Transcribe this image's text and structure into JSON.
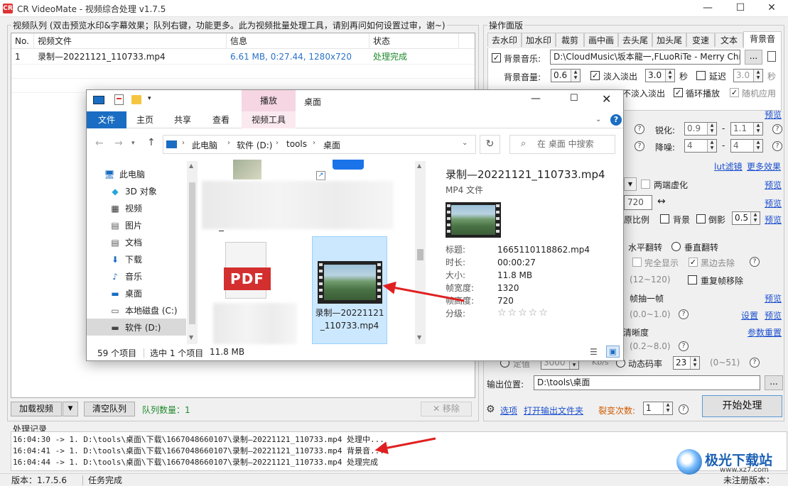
{
  "window": {
    "app_badge": "CR",
    "title": "CR VideoMate - 视频综合处理 v1.7.5",
    "minimize": "—",
    "maximize": "☐",
    "close": "✕"
  },
  "queue": {
    "label": "视频队列 (双击预览水印&字幕效果；队列右键，功能更多。此为视频批量处理工具，请别再问如何设置过审，谢~)",
    "columns": [
      "No.",
      "视频文件",
      "信息",
      "状态"
    ],
    "rows": [
      {
        "no": "1",
        "file": "录制—20221121_110733.mp4",
        "info": "6.61 MB, 0:27.44, 1280x720",
        "status": "处理完成"
      }
    ],
    "load_btn": "加载视频",
    "load_dropdown": "▼",
    "clear_btn": "清空队列",
    "count_label": "队列数量：1",
    "remove_btn": "✕ 移除",
    "colors": {
      "info": "#2a73c9",
      "status": "#1f8a2b"
    }
  },
  "panel": {
    "label": "操作面版",
    "tabs": [
      "去水印",
      "加水印",
      "裁剪",
      "画中画",
      "去头尾",
      "加头尾",
      "变速",
      "文本",
      "背景音"
    ],
    "active_tab": "背景音",
    "bgm_label": "背景音乐:",
    "bgm_path": "D:\\CloudMusic\\坂本龍一,FLuoRiTe - Merry Christ",
    "browse": "...",
    "volume_label": "背景音量:",
    "volume": "0.6",
    "fade_label": "淡入淡出",
    "fade_val": "3.0",
    "sec1": "秒",
    "delay_label": "延迟",
    "delay_val": "3.0",
    "sec2": "秒",
    "fade2_label": "不淡入淡出",
    "loop_label": "循环播放",
    "random_label": "随机应用",
    "preview": "预览",
    "sharpen_label": "锐化:",
    "sharpen_a": "0.9",
    "sharpen_b": "1.1",
    "denoise_label": "降噪:",
    "denoise_a": "4",
    "denoise_b": "4",
    "lut_link": "lut滤镜",
    "more_effects": "更多效果",
    "blur_label": "两端虚化",
    "width_val": "720",
    "swap": "↔",
    "ratio_label": "原比例",
    "bg_label": "背景",
    "shadow_label": "倒影",
    "shadow_val": "0.5",
    "hflip": "水平翻转",
    "vflip": "垂直翻转",
    "fulldisplay": "完全显示",
    "blackedge": "黑边去除",
    "fps_range": "(12~120)",
    "dup_remove": "重复帧移除",
    "frame_label": "帧抽一帧",
    "speed_range": "(0.0~1.0)",
    "settings": "设置",
    "clarity_label": "清晰度",
    "params_reset": "参数重置",
    "bitrate_range": "(0.2~8.0)",
    "fixed_label": "定值",
    "fixed_val": "3000",
    "kbs": "Kb/s",
    "dyn_label": "动态码率",
    "dyn_val": "23",
    "dyn_range": "(0~51)",
    "output_label": "输出位置:",
    "output_path": "D:\\tools\\桌面",
    "out_browse": "...",
    "options": "选项",
    "open_folder": "打开输出文件夹",
    "fission_label": "裂变次数:",
    "fission_val": "1",
    "start_btn": "开始处理",
    "help": "?"
  },
  "log": {
    "label": "处理记录",
    "lines": [
      "16:04:30 -> 1. D:\\tools\\桌面\\下载\\1667048660107\\录制—20221121_110733.mp4 处理中...",
      "16:04:41 -> 1. D:\\tools\\桌面\\下载\\1667048660107\\录制—20221121_110733.mp4 背景音...",
      "16:04:44 -> 1. D:\\tools\\桌面\\下载\\1667048660107\\录制—20221121_110733.mp4 处理完成"
    ]
  },
  "status": {
    "version": "版本：1.7.5.6",
    "task": "任务完成",
    "reg": "未注册版本："
  },
  "explorer": {
    "ctx_tab": "播放",
    "location": "桌面",
    "tabs": [
      "文件",
      "主页",
      "共享",
      "查看",
      "视频工具"
    ],
    "breadcrumb": [
      "此电脑",
      "软件 (D:)",
      "tools",
      "桌面"
    ],
    "search_placeholder": "在 桌面 中搜索",
    "nav": [
      "此电脑",
      "3D 对象",
      "视频",
      "图片",
      "文档",
      "下载",
      "音乐",
      "桌面",
      "本地磁盘 (C:)",
      "软件 (D:)"
    ],
    "nav_icons": [
      "🖥",
      "◆",
      "▦",
      "▤",
      "▤",
      "⬇",
      "♪",
      "▬",
      "▭",
      "▬"
    ],
    "pdf_label": "PDF",
    "selected_file": "录制—20221121_110733.mp4",
    "detail_title": "录制—20221121_110733.mp4",
    "detail_type": "MP4 文件",
    "details": [
      {
        "k": "标题:",
        "v": "1665110118862.mp4"
      },
      {
        "k": "时长:",
        "v": "00:00:27"
      },
      {
        "k": "大小:",
        "v": "11.8 MB"
      },
      {
        "k": "帧宽度:",
        "v": "1320"
      },
      {
        "k": "帧高度:",
        "v": "720"
      },
      {
        "k": "分级:",
        "v": "☆☆☆☆☆"
      }
    ],
    "status_count": "59 个项目",
    "status_selected": "选中 1 个项目",
    "status_size": "11.8 MB",
    "colors": {
      "file_tab": "#1a6dc2",
      "context": "#f5d6e2",
      "selection": "#cce8ff"
    }
  },
  "watermark": {
    "brand": "极光下载站",
    "url": "www.xz7.com"
  },
  "annotation_color": "#e02020"
}
